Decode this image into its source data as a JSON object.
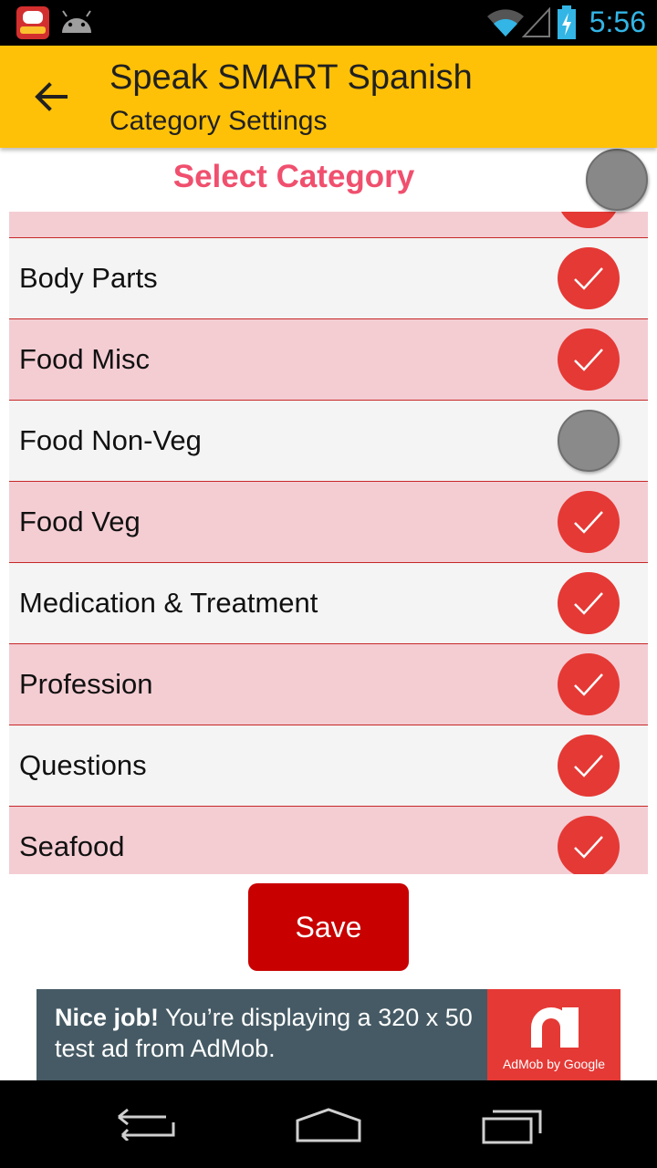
{
  "status_bar": {
    "time": "5:56",
    "icons": [
      "app-notification-icon",
      "android-icon",
      "wifi-icon",
      "signal-icon",
      "battery-charging-icon"
    ]
  },
  "toolbar": {
    "title": "Speak SMART Spanish",
    "subtitle": "Category Settings",
    "back_icon": "arrow-back-icon"
  },
  "header": {
    "title": "Select Category",
    "select_all_checked": false
  },
  "categories": [
    {
      "label": "",
      "checked": true
    },
    {
      "label": "Body Parts",
      "checked": true
    },
    {
      "label": "Food Misc",
      "checked": true
    },
    {
      "label": "Food Non-Veg",
      "checked": false
    },
    {
      "label": "Food Veg",
      "checked": true
    },
    {
      "label": "Medication & Treatment",
      "checked": true
    },
    {
      "label": "Profession",
      "checked": true
    },
    {
      "label": "Questions",
      "checked": true
    },
    {
      "label": "Seafood",
      "checked": true
    }
  ],
  "save_label": "Save",
  "ad": {
    "headline": "Nice job!",
    "body": " You’re displaying a 320 x 50 test ad from AdMob.",
    "brand": "AdMob by Google"
  },
  "colors": {
    "toolbar": "#ffc107",
    "accent_red": "#e53935",
    "header_text": "#f0506e",
    "row_pink": "#f4cdd3",
    "row_grey": "#f4f4f4",
    "save_button": "#c80000",
    "ad_background": "#455a64"
  },
  "nav_icons": [
    "nav-back-icon",
    "nav-home-icon",
    "nav-recents-icon"
  ]
}
